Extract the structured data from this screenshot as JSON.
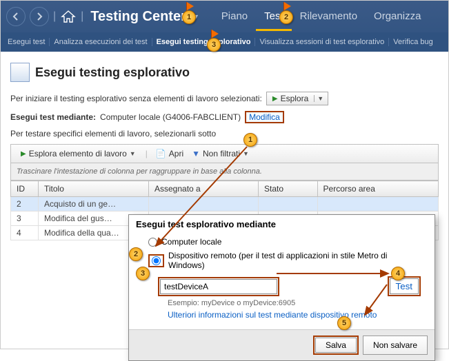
{
  "header": {
    "title": "Testing Center",
    "tabs": [
      {
        "label": "Piano",
        "active": false
      },
      {
        "label": "Test",
        "active": true
      },
      {
        "label": "Rilevamento",
        "active": false
      },
      {
        "label": "Organizza",
        "active": false
      }
    ]
  },
  "subnav": [
    {
      "label": "Esegui test",
      "active": false
    },
    {
      "label": "Analizza esecuzioni dei test",
      "active": false
    },
    {
      "label": "Esegui testing esplorativo",
      "active": true
    },
    {
      "label": "Visualizza sessioni di test esplorativo",
      "active": false
    },
    {
      "label": "Verifica bug",
      "active": false
    }
  ],
  "page": {
    "title": "Esegui testing esplorativo",
    "intro": "Per iniziare il testing esplorativo senza elementi di lavoro selezionati:",
    "explore_btn": "Esplora",
    "run_via_label": "Esegui test mediante:",
    "run_via_value": "Computer locale (G4006-FABCLIENT)",
    "modify": "Modifica",
    "specific": "Per testare specifici elementi di lavoro, selezionarli sotto"
  },
  "toolbar": {
    "explore_item": "Esplora elemento di lavoro",
    "open": "Apri",
    "filter": "Non filtrati"
  },
  "grid": {
    "drag_hint": "Trascinare l'intestazione di colonna per raggruppare in base alla colonna.",
    "cols": [
      "ID",
      "Titolo",
      "Assegnato a",
      "Stato",
      "Percorso area"
    ],
    "rows": [
      {
        "id": "2",
        "title": "Acquisto di un ge…"
      },
      {
        "id": "3",
        "title": "Modifica del gus…"
      },
      {
        "id": "4",
        "title": "Modifica della qua…"
      }
    ]
  },
  "dialog": {
    "title": "Esegui test esplorativo mediante",
    "opt_local": "Computer locale",
    "opt_remote": "Dispositivo remoto (per il test di applicazioni in stile Metro di Windows)",
    "device_value": "testDeviceA",
    "test_btn": "Test",
    "example": "Esempio: myDevice o myDevice:6905",
    "more_link": "Ulteriori informazioni sul test mediante dispositivo remoto",
    "save": "Salva",
    "dont_save": "Non salvare"
  },
  "annotations": {
    "top": [
      "1",
      "2",
      "3"
    ],
    "steps": [
      "1",
      "2",
      "3",
      "4",
      "5"
    ]
  }
}
